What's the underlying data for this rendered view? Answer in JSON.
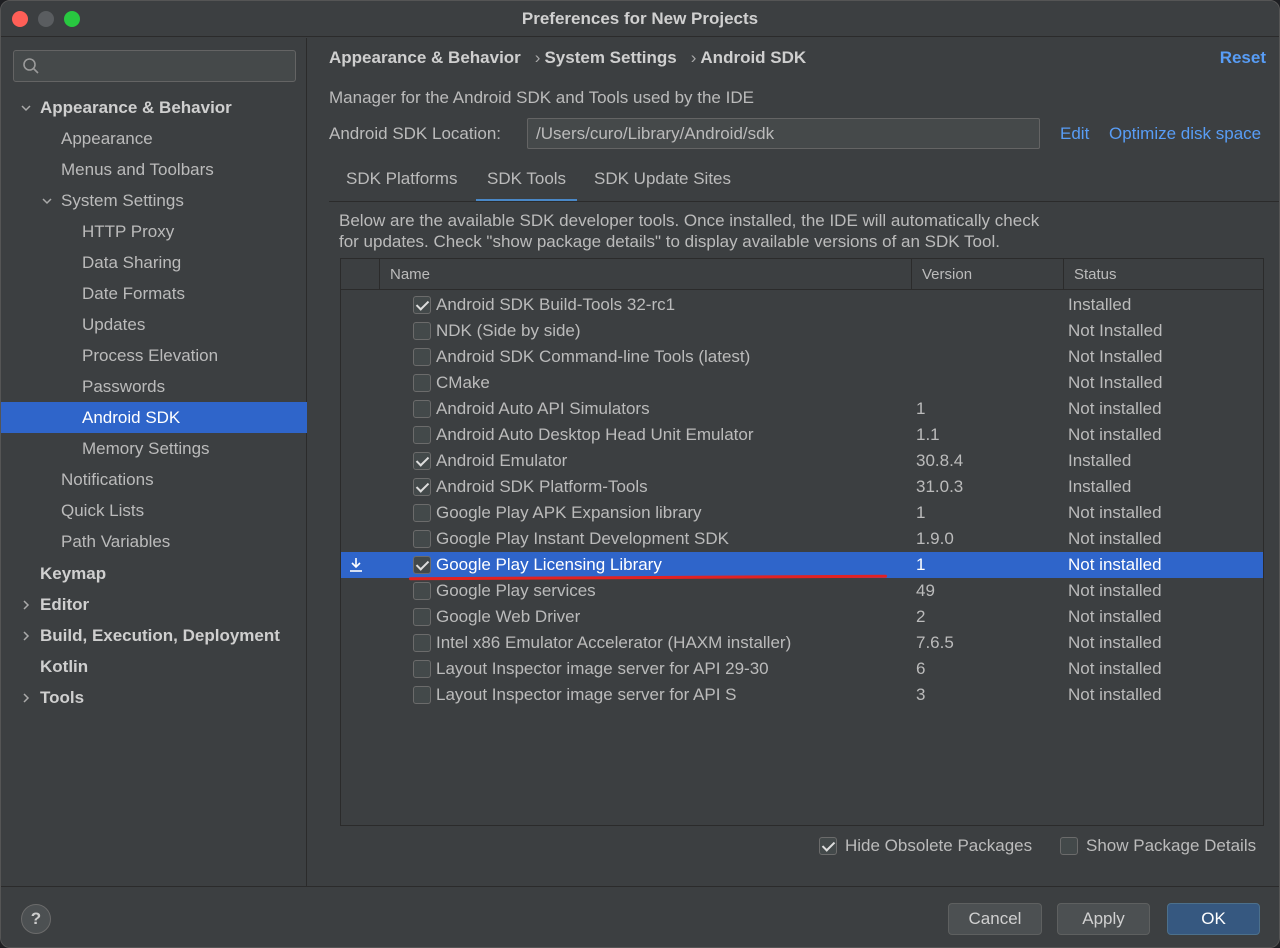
{
  "window": {
    "title": "Preferences for New Projects"
  },
  "search": {
    "placeholder": ""
  },
  "sidebar": {
    "items": [
      {
        "label": "Appearance & Behavior"
      },
      {
        "label": "Appearance"
      },
      {
        "label": "Menus and Toolbars"
      },
      {
        "label": "System Settings"
      },
      {
        "label": "HTTP Proxy"
      },
      {
        "label": "Data Sharing"
      },
      {
        "label": "Date Formats"
      },
      {
        "label": "Updates"
      },
      {
        "label": "Process Elevation"
      },
      {
        "label": "Passwords"
      },
      {
        "label": "Android SDK"
      },
      {
        "label": "Memory Settings"
      },
      {
        "label": "Notifications"
      },
      {
        "label": "Quick Lists"
      },
      {
        "label": "Path Variables"
      },
      {
        "label": "Keymap"
      },
      {
        "label": "Editor"
      },
      {
        "label": "Build, Execution, Deployment"
      },
      {
        "label": "Kotlin"
      },
      {
        "label": "Tools"
      }
    ]
  },
  "header": {
    "breadcrumb": [
      "Appearance & Behavior",
      "System Settings",
      "Android SDK"
    ],
    "separator": "›",
    "reset_label": "Reset"
  },
  "sdk": {
    "description": "Manager for the Android SDK and Tools used by the IDE",
    "location_label": "Android SDK Location:",
    "location_value": "/Users/curo/Library/Android/sdk",
    "edit_label": "Edit",
    "optimize_label": "Optimize disk space"
  },
  "tabs": [
    {
      "label": "SDK Platforms"
    },
    {
      "label": "SDK Tools"
    },
    {
      "label": "SDK Update Sites"
    }
  ],
  "panel": {
    "description_line1": "Below are the available SDK developer tools. Once installed, the IDE will automatically check",
    "description_line2": "for updates. Check \"show package details\" to display available versions of an SDK Tool."
  },
  "table": {
    "columns": [
      "Name",
      "Version",
      "Status"
    ],
    "rows": [
      {
        "name": "Android SDK Build-Tools 32-rc1",
        "version": "",
        "status": "Installed",
        "checked": true
      },
      {
        "name": "NDK (Side by side)",
        "version": "",
        "status": "Not Installed",
        "checked": false
      },
      {
        "name": "Android SDK Command-line Tools (latest)",
        "version": "",
        "status": "Not Installed",
        "checked": false
      },
      {
        "name": "CMake",
        "version": "",
        "status": "Not Installed",
        "checked": false
      },
      {
        "name": "Android Auto API Simulators",
        "version": "1",
        "status": "Not installed",
        "checked": false
      },
      {
        "name": "Android Auto Desktop Head Unit Emulator",
        "version": "1.1",
        "status": "Not installed",
        "checked": false
      },
      {
        "name": "Android Emulator",
        "version": "30.8.4",
        "status": "Installed",
        "checked": true
      },
      {
        "name": "Android SDK Platform-Tools",
        "version": "31.0.3",
        "status": "Installed",
        "checked": true
      },
      {
        "name": "Google Play APK Expansion library",
        "version": "1",
        "status": "Not installed",
        "checked": false
      },
      {
        "name": "Google Play Instant Development SDK",
        "version": "1.9.0",
        "status": "Not installed",
        "checked": false
      },
      {
        "name": "Google Play Licensing Library",
        "version": "1",
        "status": "Not installed",
        "checked": true
      },
      {
        "name": "Google Play services",
        "version": "49",
        "status": "Not installed",
        "checked": false
      },
      {
        "name": "Google Web Driver",
        "version": "2",
        "status": "Not installed",
        "checked": false
      },
      {
        "name": "Intel x86 Emulator Accelerator (HAXM installer)",
        "version": "7.6.5",
        "status": "Not installed",
        "checked": false
      },
      {
        "name": "Layout Inspector image server for API 29-30",
        "version": "6",
        "status": "Not installed",
        "checked": false
      },
      {
        "name": "Layout Inspector image server for API S",
        "version": "3",
        "status": "Not installed",
        "checked": false
      }
    ]
  },
  "options": {
    "hide_obsolete_label": "Hide Obsolete Packages",
    "show_details_label": "Show Package Details"
  },
  "footer": {
    "help_label": "?",
    "cancel_label": "Cancel",
    "apply_label": "Apply",
    "ok_label": "OK"
  },
  "colors": {
    "accent": "#2f65ca",
    "link": "#589df6",
    "annotation": "#e22222"
  }
}
